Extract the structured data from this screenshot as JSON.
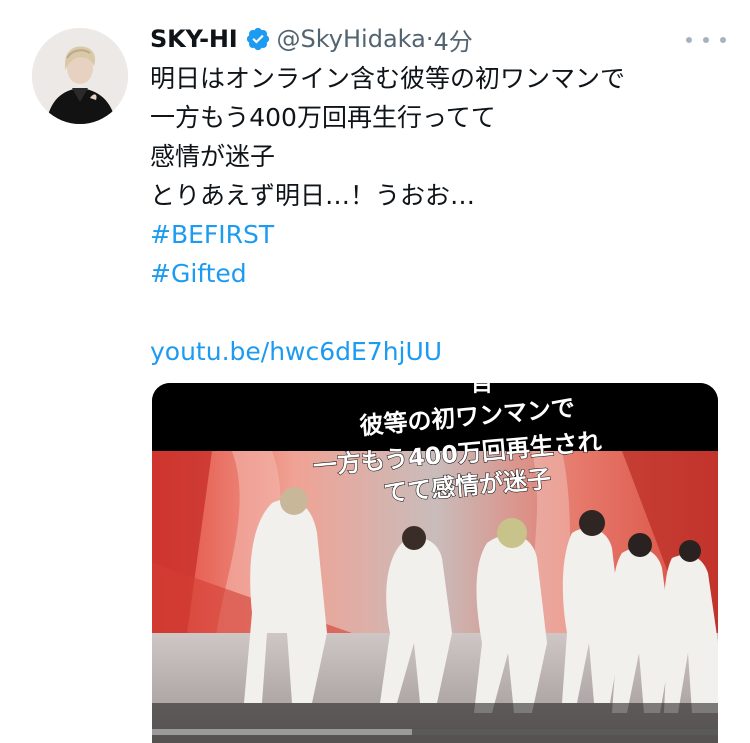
{
  "user": {
    "name": "SKY-HI",
    "handle": "@SkyHidaka",
    "separator": "·",
    "time": "4分",
    "verified": true,
    "verified_icon": "verified-badge-icon",
    "accent": "#1d9bf0"
  },
  "tweet": {
    "lines": [
      "明日はオンライン含む彼等の初ワンマンで",
      "一方もう400万回再生行ってて",
      "感情が迷子",
      "とりあえず明日…！うおお…"
    ],
    "hashtags": [
      "#BEFIRST",
      "#Gifted"
    ],
    "link": "youtu.be/hwc6dE7hjUU"
  },
  "media": {
    "caption_lines": [
      "彼等の初ワンマンで",
      "一方もう400万回再生され",
      "てて感情が迷子"
    ]
  },
  "icons": {
    "more": "more-options-icon"
  }
}
